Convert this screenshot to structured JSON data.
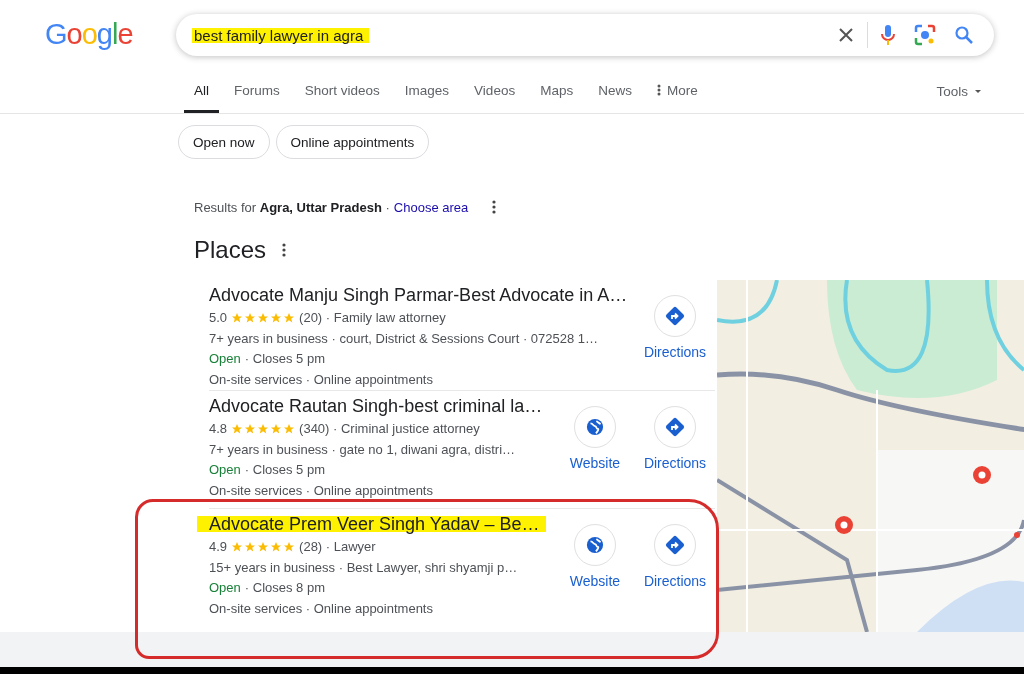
{
  "logo": {
    "letters": [
      {
        "char": "G",
        "color": "#4285f4"
      },
      {
        "char": "o",
        "color": "#ea4335"
      },
      {
        "char": "o",
        "color": "#fbbc05"
      },
      {
        "char": "g",
        "color": "#4285f4"
      },
      {
        "char": "l",
        "color": "#34a853"
      },
      {
        "char": "e",
        "color": "#ea4335"
      }
    ]
  },
  "search": {
    "value": "best family lawyer in agra",
    "highlighted": true
  },
  "tabs": [
    {
      "label": "All",
      "selected": true,
      "kind": "plain"
    },
    {
      "label": "Forums",
      "selected": false,
      "kind": "plain"
    },
    {
      "label": "Short videos",
      "selected": false,
      "kind": "plain"
    },
    {
      "label": "Images",
      "selected": false,
      "kind": "plain"
    },
    {
      "label": "Videos",
      "selected": false,
      "kind": "plain"
    },
    {
      "label": "Maps",
      "selected": false,
      "kind": "plain"
    },
    {
      "label": "News",
      "selected": false,
      "kind": "plain"
    },
    {
      "label": "More",
      "selected": false,
      "kind": "more"
    }
  ],
  "tools": "Tools",
  "chips": [
    "Open now",
    "Online appointments"
  ],
  "location": {
    "text": "Results for **Agra, Uttar Pradesh** ·",
    "link": "Choose area"
  },
  "places": {
    "heading": "Places",
    "results": [
      {
        "title": "Advocate Manju Singh Parmar-Best Advocate in A…",
        "highlighted": false,
        "circled": false,
        "rating": "5.0",
        "stars": 5,
        "reviews": "(20) · Family law attorney",
        "details": "7+ years in business · court, District & Sessions Court · 072528 1…",
        "status": "Open",
        "hours": "· Closes 5 pm",
        "services": "On-site services · Online appointments",
        "buttons": [
          {
            "kind": "directions",
            "label": "Directions"
          }
        ]
      },
      {
        "title": "Advocate Rautan Singh-best criminal la…",
        "highlighted": false,
        "circled": false,
        "rating": "4.8",
        "stars": 5,
        "reviews": "(340) · Criminal justice attorney",
        "details": "7+ years in business · gate no 1, diwani agra, distri…",
        "status": "Open",
        "hours": "· Closes 5 pm",
        "services": "On-site services · Online appointments",
        "buttons": [
          {
            "kind": "website",
            "label": "Website"
          },
          {
            "kind": "directions",
            "label": "Directions"
          }
        ]
      },
      {
        "title": "Advocate Prem Veer Singh Yadav – Be…",
        "highlighted": true,
        "circled": true,
        "rating": "4.9",
        "stars": 5,
        "reviews": "(28) · Lawyer",
        "details": "15+ years in business · Best Lawyer, shri shyamji p…",
        "status": "Open",
        "hours": "· Closes 8 pm",
        "services": "On-site services · Online appointments",
        "buttons": [
          {
            "kind": "website",
            "label": "Website"
          },
          {
            "kind": "directions",
            "label": "Directions"
          }
        ]
      }
    ]
  }
}
